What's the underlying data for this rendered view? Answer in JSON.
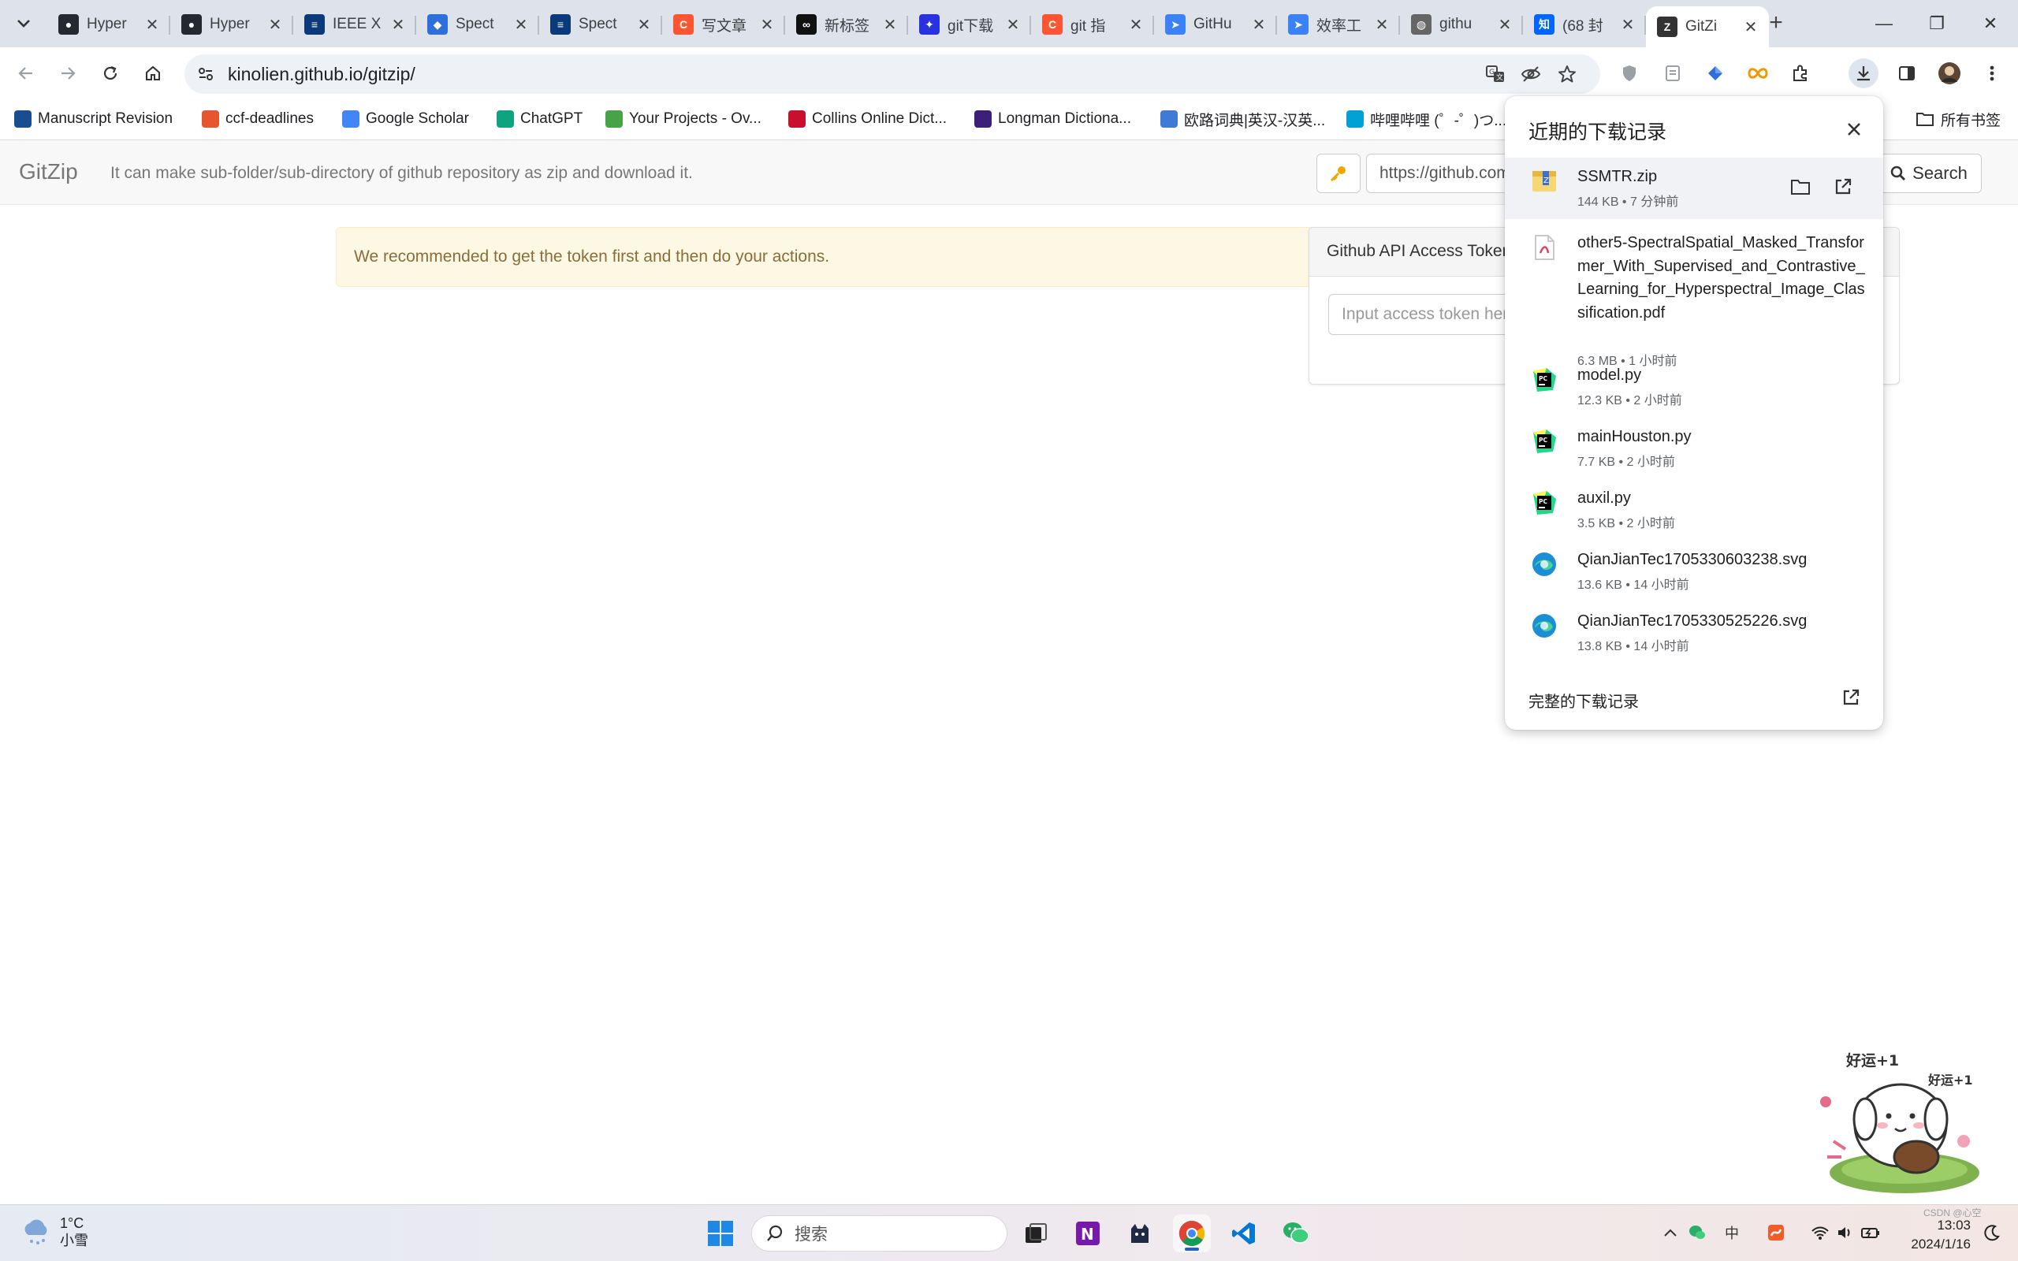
{
  "tabs": [
    {
      "title": "Hyper",
      "icon": "github-icon",
      "color": "#24292f"
    },
    {
      "title": "Hyper",
      "icon": "github-icon",
      "color": "#24292f"
    },
    {
      "title": "IEEE X",
      "icon": "ieee-icon",
      "color": "#0a3a7a"
    },
    {
      "title": "Spect",
      "icon": "diamond-icon",
      "color": "#2f6fdb"
    },
    {
      "title": "Spect",
      "icon": "ieee-icon",
      "color": "#0a3a7a"
    },
    {
      "title": "写文章",
      "icon": "csdn-icon",
      "color": "#fc5531"
    },
    {
      "title": "新标签",
      "icon": "infinity-icon",
      "color": "#111111"
    },
    {
      "title": "git下载",
      "icon": "baidu-icon",
      "color": "#2932e1"
    },
    {
      "title": "git 指",
      "icon": "csdn-icon",
      "color": "#fc5531"
    },
    {
      "title": "GitHu",
      "icon": "rocket-icon",
      "color": "#3b82f6"
    },
    {
      "title": "效率工",
      "icon": "rocket-icon",
      "color": "#3b82f6"
    },
    {
      "title": "githu",
      "icon": "globe-icon",
      "color": "#666666"
    },
    {
      "title": "(68 封",
      "icon": "zhihu-icon",
      "color": "#0066ff"
    },
    {
      "title": "GitZi",
      "icon": "gitzip-icon",
      "color": "#333333",
      "active": true
    }
  ],
  "window": {
    "minimize": "—",
    "restore": "❐",
    "close": "✕"
  },
  "toolbar": {
    "url": "kinolien.github.io/gitzip/"
  },
  "bookmarks": [
    {
      "label": "Manuscript Revision",
      "color": "#1a4d8f"
    },
    {
      "label": "ccf-deadlines",
      "color": "#e8542f"
    },
    {
      "label": "Google Scholar",
      "color": "#4285f4"
    },
    {
      "label": "ChatGPT",
      "color": "#10a37f"
    },
    {
      "label": "Your Projects - Ov...",
      "color": "#47a248"
    },
    {
      "label": "Collins Online Dict...",
      "color": "#c8102e"
    },
    {
      "label": "Longman Dictiona...",
      "color": "#3b1f7a"
    },
    {
      "label": "欧路词典|英汉-汉英...",
      "color": "#3f7ad6"
    },
    {
      "label": "哔哩哔哩 (゜-゜)つ...",
      "color": "#00a1d6"
    }
  ],
  "bookmarks_folder": "所有书签",
  "gitzip": {
    "brand": "GitZip",
    "description": "It can make sub-folder/sub-directory of github repository as zip and download it.",
    "url_input": "https://github.com/",
    "search": "Search",
    "alert": "We recommended to get the token first and then do your actions.",
    "token_title": "Github API Access Token",
    "token_placeholder": "Input access token here"
  },
  "downloads": {
    "title": "近期的下载记录",
    "footer": "完整的下载记录",
    "items": [
      {
        "name": "SSMTR.zip",
        "meta": "144 KB • 7 分钟前",
        "type": "zip"
      },
      {
        "name": "other5-SpectralSpatial_Masked_Transformer_With_Supervised_and_Contrastive_Learning_for_Hyperspectral_Image_Classification.pdf",
        "meta": "6.3 MB • 1 小时前",
        "type": "pdf"
      },
      {
        "name": "model.py",
        "meta": "12.3 KB • 2 小时前",
        "type": "pycharm"
      },
      {
        "name": "mainHouston.py",
        "meta": "7.7 KB • 2 小时前",
        "type": "pycharm"
      },
      {
        "name": "auxil.py",
        "meta": "3.5 KB • 2 小时前",
        "type": "pycharm"
      },
      {
        "name": "QianJianTec1705330603238.svg",
        "meta": "13.6 KB • 14 小时前",
        "type": "edge"
      },
      {
        "name": "QianJianTec1705330525226.svg",
        "meta": "13.8 KB • 14 小时前",
        "type": "edge"
      }
    ]
  },
  "sticker": {
    "line1": "好运+1",
    "line2": "好运+1"
  },
  "taskbar": {
    "temp": "1°C",
    "weather": "小雪",
    "search": "搜索",
    "ime": "中",
    "time": "13:03",
    "date": "2024/1/16",
    "watermark": "CSDN @心空"
  }
}
